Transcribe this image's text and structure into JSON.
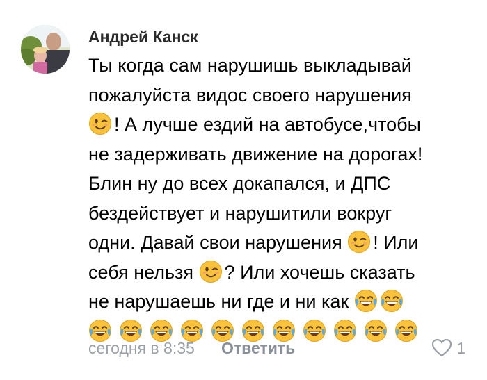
{
  "comment": {
    "author": "Андрей Канск",
    "lines": [
      {
        "pre": "",
        "emoji": [],
        "post": "Ты когда сам нарушишь выкладывай"
      },
      {
        "pre": "",
        "emoji": [],
        "post": "пожалуйста видос своего нарушения"
      },
      {
        "pre": "",
        "emoji": [
          "winking-face"
        ],
        "post": "! А лучше ездий на автобусе,чтобы"
      },
      {
        "pre": "",
        "emoji": [],
        "post": "не задерживать движение на дорогах!"
      },
      {
        "pre": "",
        "emoji": [],
        "post": "Блин ну до всех докапался, и ДПС"
      },
      {
        "pre": "",
        "emoji": [],
        "post": "бездействует и нарушитили вокруг"
      },
      {
        "pre": "одни. Давай свои нарушения ",
        "emoji": [
          "winking-face"
        ],
        "post": "! Или"
      },
      {
        "pre": "себя нельзя ",
        "emoji": [
          "winking-face"
        ],
        "post": "? Или хочешь сказать"
      },
      {
        "pre": "не нарушаешь ни где и ни как ",
        "emoji": [
          "tears-of-joy-face",
          "tears-of-joy-face"
        ],
        "post": ""
      }
    ],
    "emoji_row": [
      "tears-of-joy-face",
      "tears-of-joy-face",
      "tears-of-joy-face",
      "tears-of-joy-face",
      "tears-of-joy-face",
      "tears-of-joy-face",
      "tears-of-joy-face",
      "tears-of-joy-face",
      "tears-of-joy-face",
      "tears-of-joy-face",
      "tears-of-joy-face"
    ],
    "time": "сегодня в 8:35",
    "reply_label": "Ответить",
    "like_count": "1",
    "like_icon": "heart-outline-icon"
  },
  "colors": {
    "text": "#000000",
    "author": "#2a2a2a",
    "meta": "#9aa0a6",
    "reply": "#8a9099",
    "emoji_face": "#f9c23c",
    "emoji_tears": "#5aa9e6"
  }
}
